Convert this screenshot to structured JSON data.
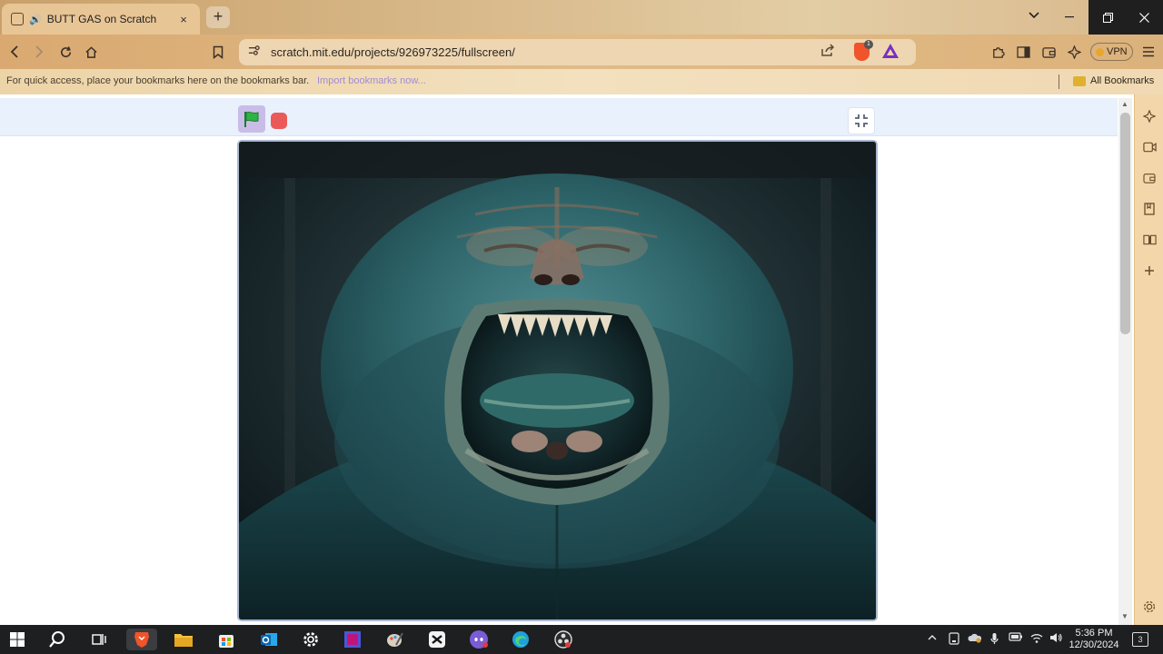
{
  "browser": {
    "tab": {
      "title": "BUTT GAS on Scratch",
      "audio_icon": "speaker-icon",
      "close_glyph": "×"
    },
    "new_tab_glyph": "+",
    "url": "scratch.mit.edu/projects/926973225/fullscreen/",
    "shields_count": "1",
    "vpn_label": "VPN"
  },
  "bookmarks_bar": {
    "hint": "For quick access, place your bookmarks here on the bookmarks bar.",
    "import_link": "Import bookmarks now...",
    "all_bookmarks": "All Bookmarks"
  },
  "scratch": {
    "green_flag_color": "#2fb344",
    "stop_color": "#ec5959",
    "stage_description_color": "#1d5a63"
  },
  "taskbar": {
    "time": "5:36 PM",
    "date": "12/30/2024",
    "notification_count": "3"
  },
  "colors": {
    "accent": "#d9a971",
    "scratch_menu": "#e9f1fc"
  }
}
